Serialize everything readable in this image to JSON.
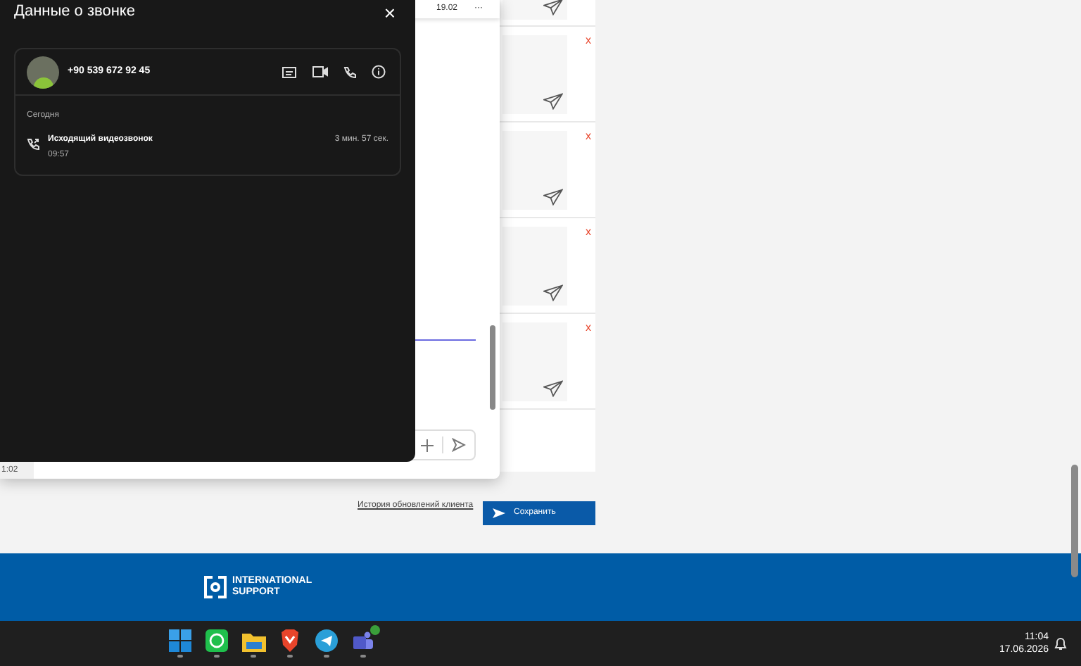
{
  "call_dialog": {
    "title": "Данные о звонке",
    "close": "×",
    "contact": {
      "phone": "+90 539 672 92 45"
    },
    "section": "Сегодня",
    "calls": [
      {
        "kind": "outgoing",
        "label": "Исходящий видеозвонок",
        "time": "09:57",
        "duration": "3 мин. 57 сек."
      }
    ]
  },
  "chat_window": {
    "header_date": "19.02",
    "menu": "···",
    "time": "1:02"
  },
  "cards": [
    {
      "kind": "partial"
    },
    {
      "kind": "full",
      "close": "x"
    },
    {
      "kind": "full",
      "close": "x"
    },
    {
      "kind": "full",
      "close": "x"
    },
    {
      "kind": "full",
      "close": "x"
    }
  ],
  "history_link": "История обновлений клиента",
  "save_button": "Сохранить",
  "footer": {
    "brand_line_1": "INTERNATIONAL",
    "brand_line_2": "SUPPORT"
  },
  "taskbar": {
    "apps": [
      {
        "kind": "start",
        "selected": false
      },
      {
        "kind": "whatsapp",
        "selected": false
      },
      {
        "kind": "folder",
        "selected": false
      },
      {
        "kind": "brave",
        "selected": false
      },
      {
        "kind": "telegram",
        "selected": false
      },
      {
        "kind": "teams",
        "selected": false
      }
    ],
    "time": "11:04",
    "date": "17.06.2026"
  }
}
